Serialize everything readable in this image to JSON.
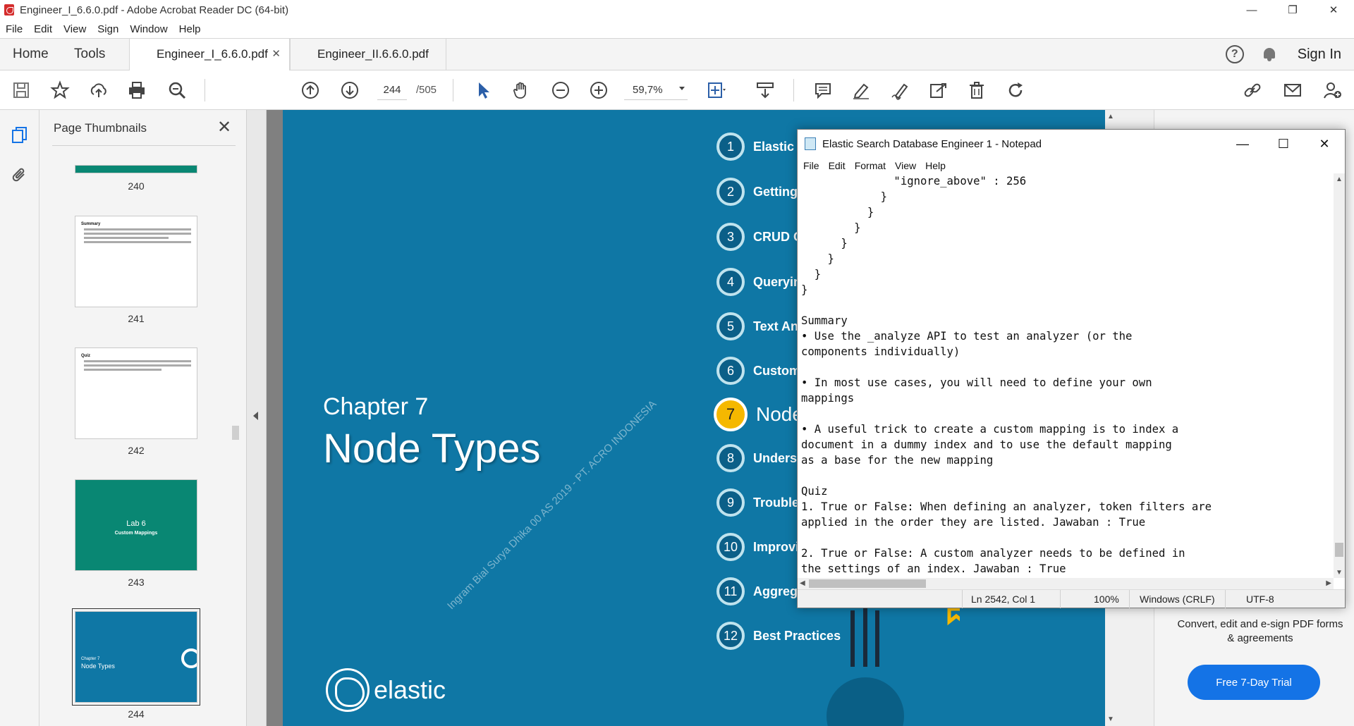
{
  "acrobat": {
    "window_title": "Engineer_I_6.6.0.pdf - Adobe Acrobat Reader DC (64-bit)",
    "menu": [
      "File",
      "Edit",
      "View",
      "Sign",
      "Window",
      "Help"
    ],
    "nav_tabs": [
      "Home",
      "Tools"
    ],
    "doc_tabs": [
      {
        "label": "Engineer_I_6.6.0.pdf",
        "active": true
      },
      {
        "label": "Engineer_II.6.6.0.pdf",
        "active": false
      }
    ],
    "sign_in": "Sign In",
    "toolbar": {
      "current_page": "244",
      "page_slash": "/",
      "total_pages": "505",
      "zoom": "59,7%"
    }
  },
  "thumbnails": {
    "title": "Page Thumbnails",
    "pages": [
      {
        "num": "240"
      },
      {
        "num": "241",
        "heading": "Summary"
      },
      {
        "num": "242",
        "heading": "Quiz"
      },
      {
        "num": "243",
        "heading": "Lab 6",
        "sub": "Custom Mappings"
      },
      {
        "num": "244",
        "heading": "Chapter 7",
        "sub": "Node Types"
      }
    ]
  },
  "slide": {
    "chapter_label": "Chapter 7",
    "chapter_title": "Node Types",
    "brand": "elastic",
    "watermark": "Ingram Bial Surya Dhika 00 AS 2019 - PT. ACRO INDONESIA",
    "toc": [
      {
        "num": "1",
        "label": "Elastic S"
      },
      {
        "num": "2",
        "label": "Getting S"
      },
      {
        "num": "3",
        "label": "CRUD O"
      },
      {
        "num": "4",
        "label": "Querying"
      },
      {
        "num": "5",
        "label": "Text Ana"
      },
      {
        "num": "6",
        "label": "Custom"
      },
      {
        "num": "7",
        "label": "Node",
        "active": true
      },
      {
        "num": "8",
        "label": "Understa"
      },
      {
        "num": "9",
        "label": "Troubles"
      },
      {
        "num": "10",
        "label": "Improvin"
      },
      {
        "num": "11",
        "label": "Aggregating Data"
      },
      {
        "num": "12",
        "label": "Best Practices"
      }
    ]
  },
  "promo": {
    "text": "Convert, edit and e-sign PDF forms & agreements",
    "button": "Free 7-Day Trial",
    "button_color": "#1473e6"
  },
  "notepad": {
    "title": "Elastic Search Database Engineer 1 - Notepad",
    "menu": [
      "File",
      "Edit",
      "Format",
      "View",
      "Help"
    ],
    "lines": [
      "              \"ignore_above\" : 256",
      "            }",
      "          }",
      "        }",
      "      }",
      "    }",
      "  }",
      "}",
      "",
      "Summary",
      "• Use the _analyze API to test an analyzer (or the",
      "components individually)",
      "",
      "• In most use cases, you will need to define your own",
      "mappings",
      "",
      "• A useful trick to create a custom mapping is to index a",
      "document in a dummy index and to use the default mapping",
      "as a base for the new mapping",
      "",
      "Quiz",
      "1. True or False: When defining an analyzer, token filters are",
      "applied in the order they are listed. Jawaban : True",
      "",
      "2. True or False: A custom analyzer needs to be defined in",
      "the settings of an index. Jawaban : True"
    ],
    "status": {
      "position": "Ln 2542, Col 1",
      "zoom": "100%",
      "line_ending": "Windows (CRLF)",
      "encoding": "UTF-8"
    }
  }
}
